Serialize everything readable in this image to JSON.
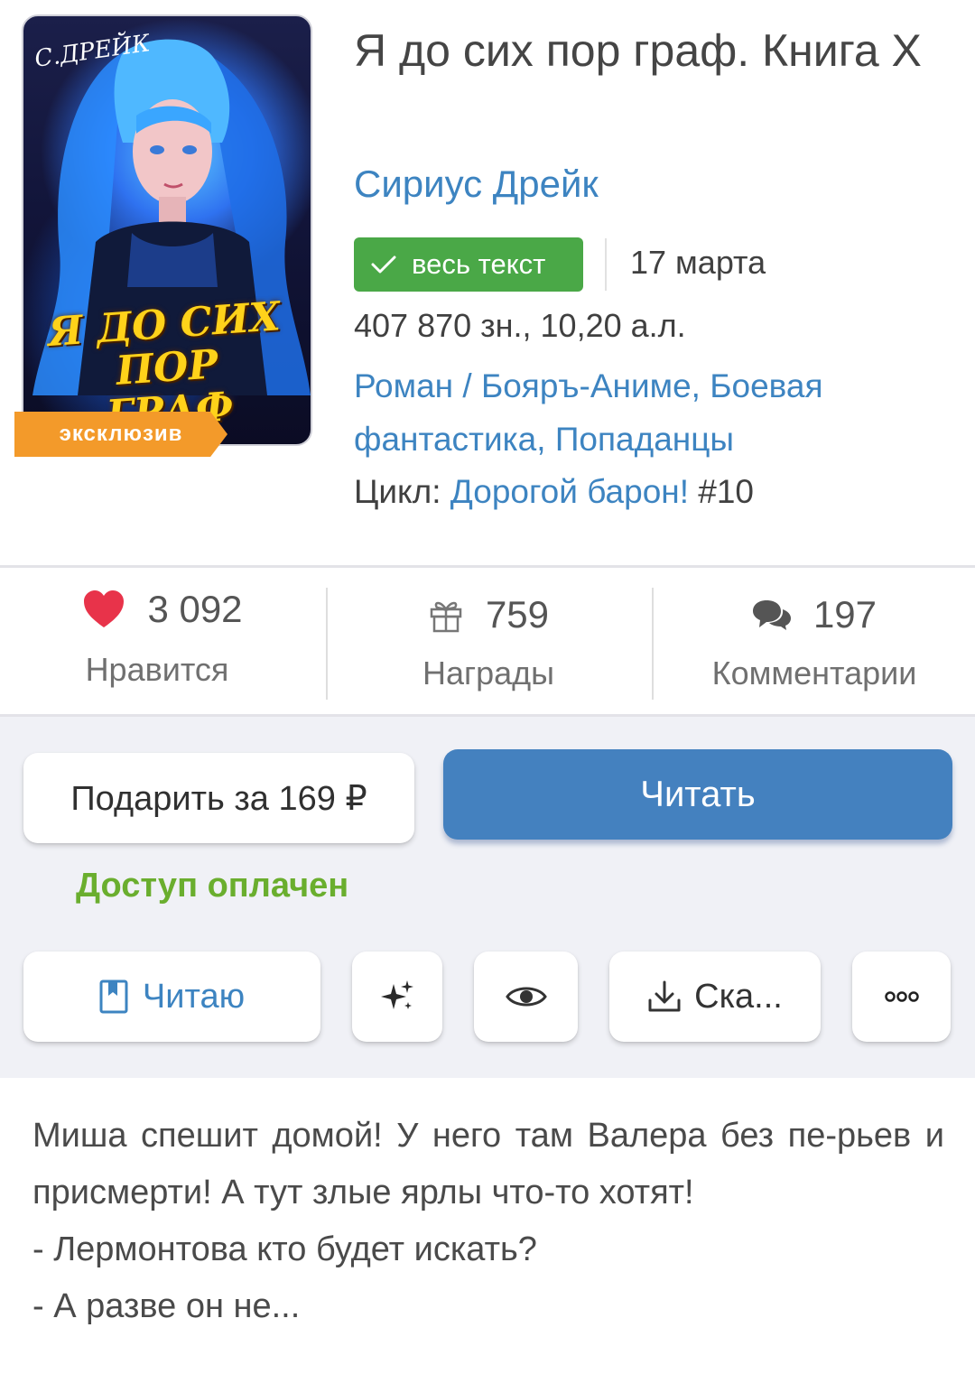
{
  "book": {
    "cover_author": "С.ДРЕЙК",
    "cover_title_line1": "Я ДО СИХ ПОР",
    "cover_title_line2": "ГРАФ",
    "exclusive_badge": "эксклюзив",
    "title": "Я до сих пор граф. Книга X",
    "author": "Сириус Дрейк",
    "status": "весь текст",
    "date": "17 марта",
    "size": "407 870 зн., 10,20 а.л.",
    "genres": [
      "Роман",
      "Бояръ-Аниме",
      "Боевая фантастика",
      "Попаданцы"
    ],
    "genre_separators": [
      " / ",
      ", ",
      ", "
    ],
    "cycle_label": "Цикл: ",
    "cycle_name": "Дорогой барон!",
    "cycle_number": " #10"
  },
  "stats": {
    "likes": {
      "value": "3 092",
      "label": "Нравится",
      "icon": "heart-icon"
    },
    "awards": {
      "value": "759",
      "label": "Награды",
      "icon": "gift-icon"
    },
    "comments": {
      "value": "197",
      "label": "Комментарии",
      "icon": "comments-icon"
    }
  },
  "actions": {
    "gift_label": "Подарить за 169 ₽",
    "read_label": "Читать",
    "paid_status": "Доступ оплачен",
    "reading_label": "Читаю",
    "download_label": "Ска...",
    "icons": [
      "bookmark-icon",
      "sparkles-icon",
      "eye-icon",
      "download-icon",
      "more-icon"
    ]
  },
  "description": {
    "paragraph1": "Миша спешит домой! У него там Валера без пе-рьев и присмерти! А тут злые ярлы что-то хотят!",
    "paragraph2": "- Лермонтова кто будет искать?",
    "paragraph3": "- А разве он не..."
  },
  "colors": {
    "accent": "#4481bf",
    "link": "#3d84c1",
    "status_green": "#4aa847",
    "paid_green": "#6aae2e",
    "badge_orange": "#f39a2a",
    "heart_red": "#e8334a"
  }
}
